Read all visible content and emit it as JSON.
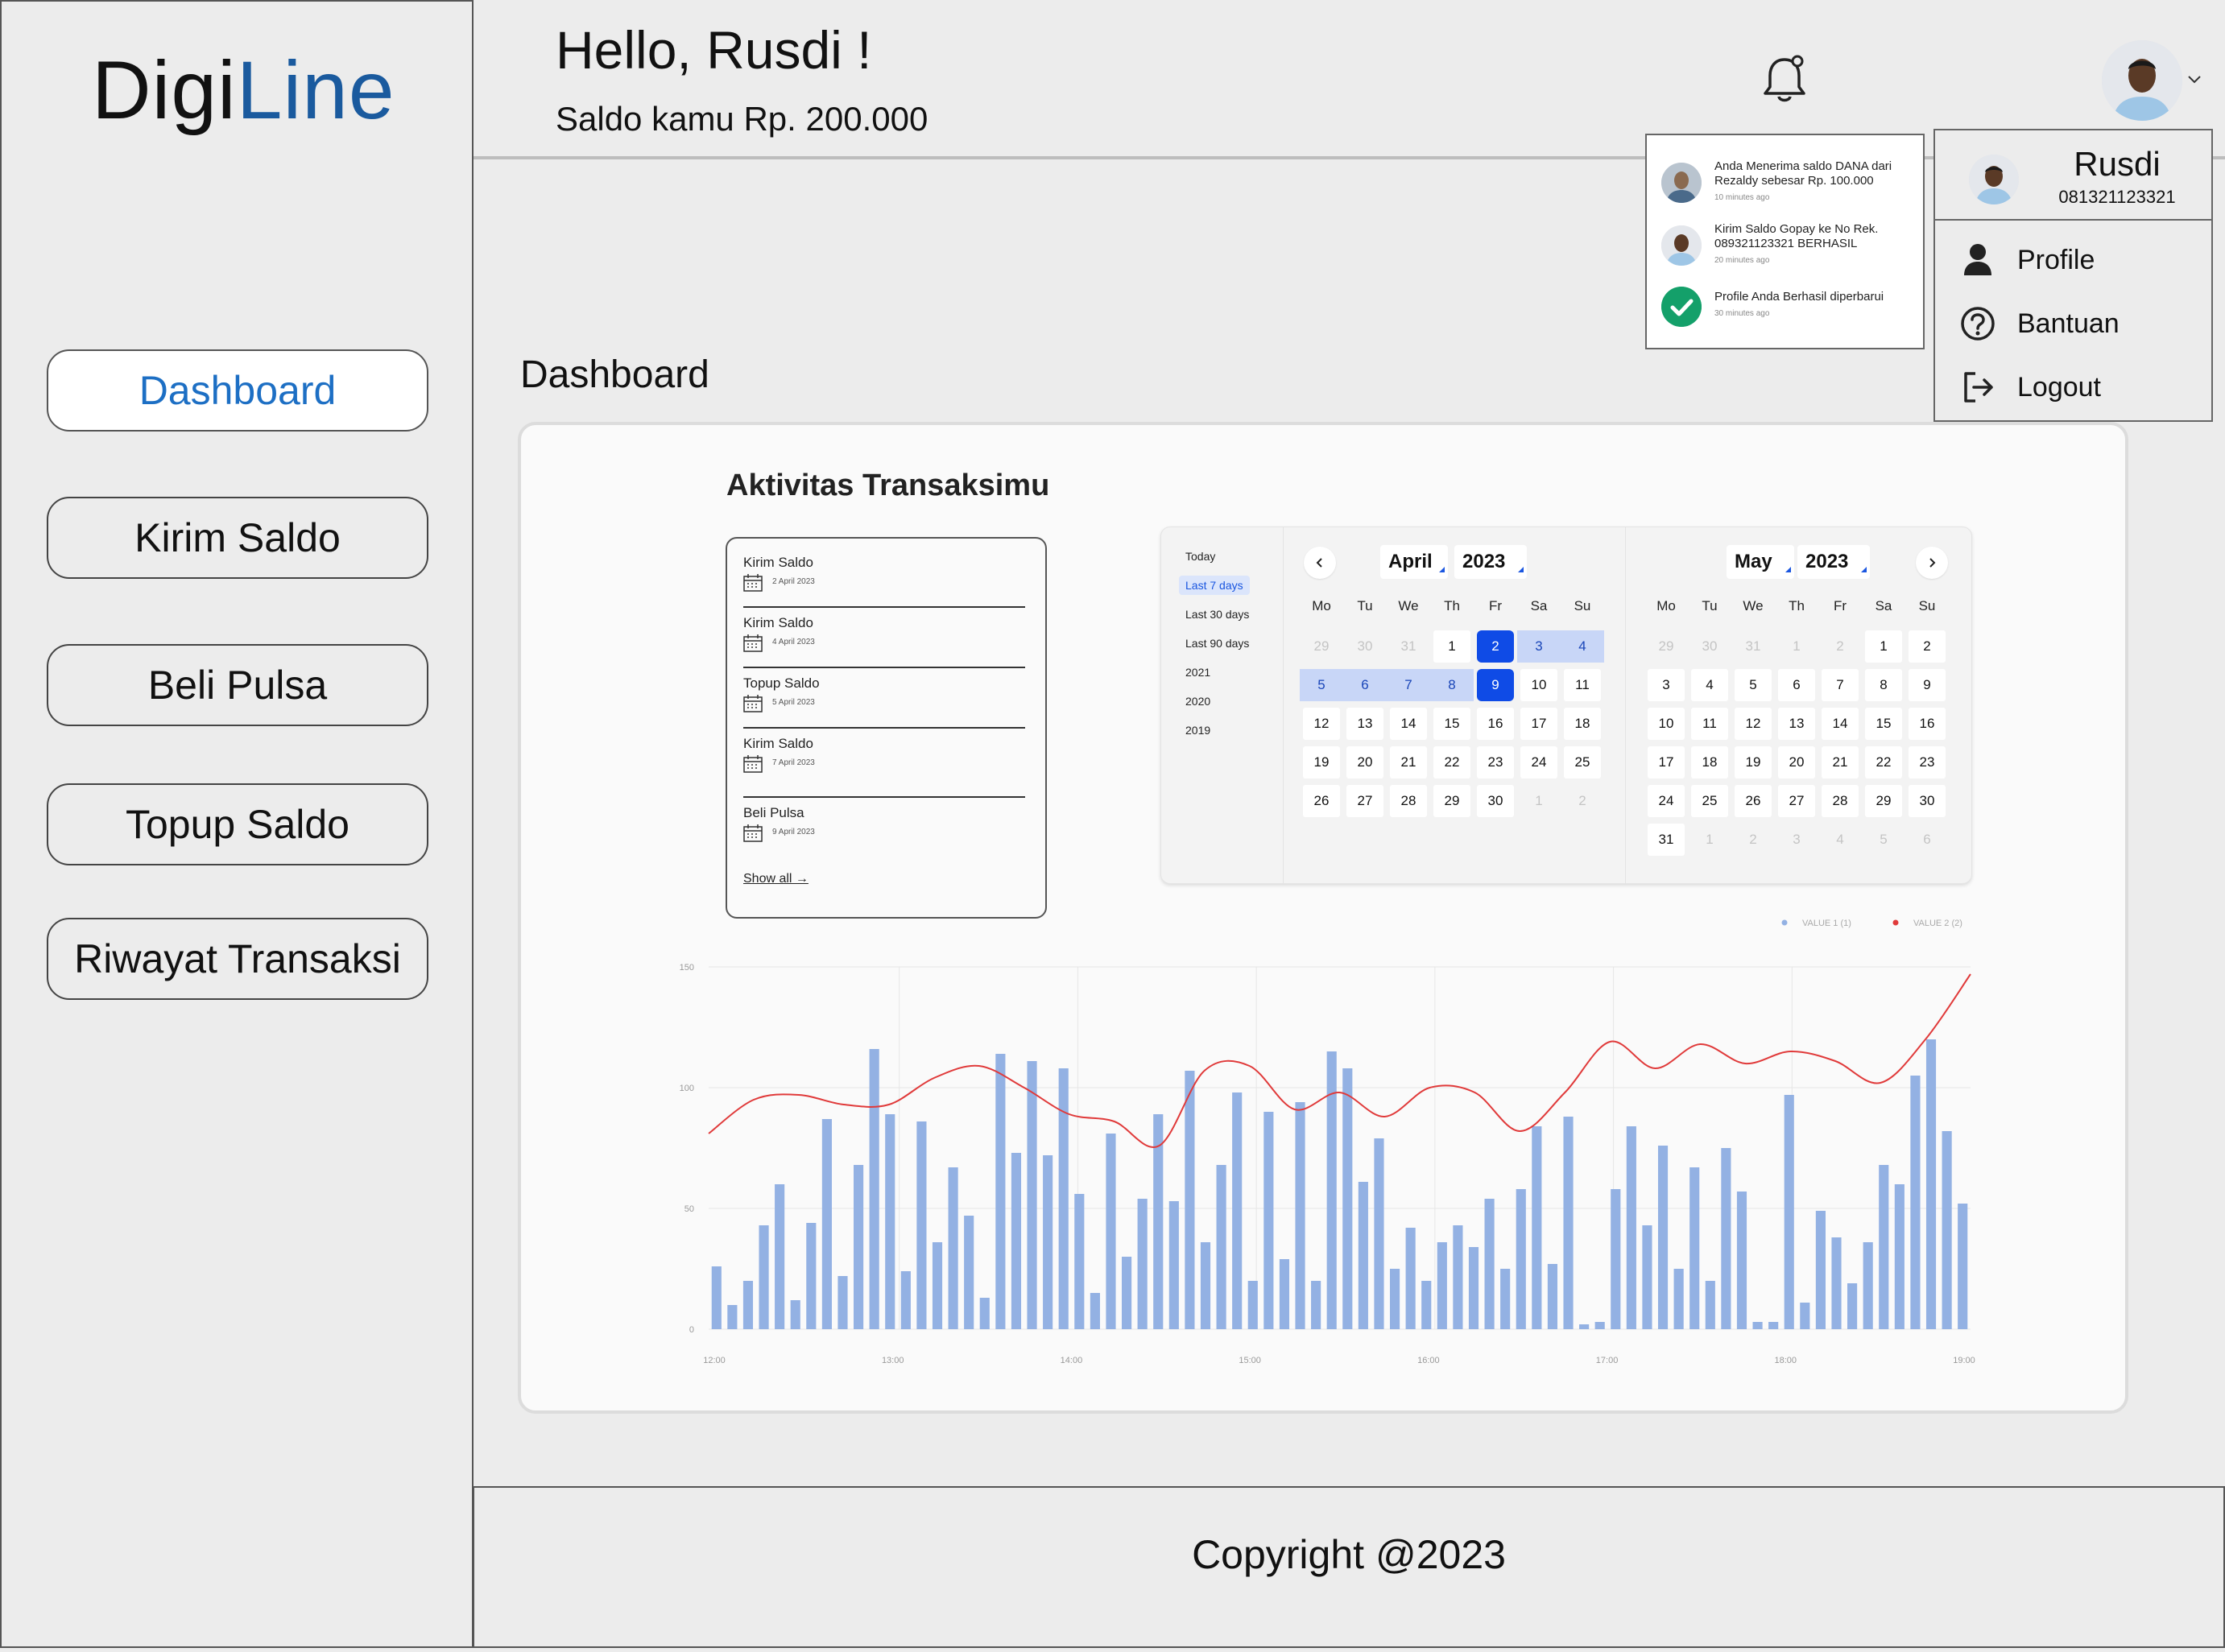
{
  "app": {
    "logo_a": "Digi",
    "logo_b": "Line"
  },
  "sidebar": {
    "items": [
      {
        "label": "Dashboard",
        "active": true
      },
      {
        "label": "Kirim Saldo"
      },
      {
        "label": "Beli Pulsa"
      },
      {
        "label": "Topup Saldo"
      },
      {
        "label": "Riwayat Transaksi"
      }
    ]
  },
  "header": {
    "greeting": "Hello, Rusdi !",
    "saldo": "Saldo kamu Rp. 200.000",
    "bell_icon": "bell-icon"
  },
  "notifications": [
    {
      "text": "Anda Menerima saldo DANA dari Rezaldy sebesar Rp. 100.000",
      "time": "10 minutes ago",
      "icon": "avatar"
    },
    {
      "text": "Kirim Saldo Gopay ke No Rek. 089321123321 BERHASIL",
      "time": "20 minutes ago",
      "icon": "avatar"
    },
    {
      "text": "Profile Anda Berhasil diperbarui",
      "time": "30 minutes ago",
      "icon": "check-circle-icon"
    }
  ],
  "profile_menu": {
    "name": "Rusdi",
    "phone": "081321123321",
    "items": [
      {
        "label": "Profile",
        "icon": "user-icon"
      },
      {
        "label": "Bantuan",
        "icon": "help-icon"
      },
      {
        "label": "Logout",
        "icon": "logout-icon"
      }
    ]
  },
  "main": {
    "title": "Dashboard",
    "card_title": "Aktivitas Transaksimu",
    "activity": [
      {
        "name": "Kirim Saldo",
        "date": "2 April 2023"
      },
      {
        "name": "Kirim Saldo",
        "date": "4 April 2023"
      },
      {
        "name": "Topup Saldo",
        "date": "5 April 2023"
      },
      {
        "name": "Kirim Saldo",
        "date": "7 April 2023"
      },
      {
        "name": "Beli Pulsa",
        "date": "9 April 2023"
      }
    ],
    "show_all": "Show all →"
  },
  "calendar": {
    "presets": [
      "Today",
      "Last 7 days",
      "Last 30 days",
      "Last 90 days",
      "2021",
      "2020",
      "2019"
    ],
    "selected_preset": "Last 7 days",
    "weekdays": [
      "Mo",
      "Tu",
      "We",
      "Th",
      "Fr",
      "Sa",
      "Su"
    ],
    "left": {
      "month": "April",
      "year": "2023",
      "weeks": [
        [
          "29",
          "30",
          "31",
          "1",
          "2",
          "3",
          "4"
        ],
        [
          "5",
          "6",
          "7",
          "8",
          "9",
          "10",
          "11"
        ],
        [
          "12",
          "13",
          "14",
          "15",
          "16",
          "17",
          "18"
        ],
        [
          "19",
          "20",
          "21",
          "22",
          "23",
          "24",
          "25"
        ],
        [
          "26",
          "27",
          "28",
          "29",
          "30",
          "1",
          "2"
        ]
      ]
    },
    "right": {
      "month": "May",
      "year": "2023",
      "weeks": [
        [
          "29",
          "30",
          "31",
          "1",
          "2",
          "1",
          "2"
        ],
        [
          "3",
          "4",
          "5",
          "6",
          "7",
          "8",
          "9"
        ],
        [
          "10",
          "11",
          "12",
          "13",
          "14",
          "15",
          "16"
        ],
        [
          "17",
          "18",
          "19",
          "20",
          "21",
          "22",
          "23"
        ],
        [
          "24",
          "25",
          "26",
          "27",
          "28",
          "29",
          "30"
        ],
        [
          "31",
          "1",
          "2",
          "3",
          "4",
          "5",
          "6"
        ]
      ]
    },
    "range_start": "2",
    "range_end": "9"
  },
  "chart_data": {
    "type": "bar",
    "x_ticks": [
      "12:00",
      "13:00",
      "14:00",
      "15:00",
      "16:00",
      "17:00",
      "18:00",
      "19:00"
    ],
    "y_ticks": [
      "0",
      "50",
      "100",
      "150"
    ],
    "ylim": [
      0,
      150
    ],
    "legend": [
      {
        "name": "VALUE 1 (1)",
        "color": "#93b1e3"
      },
      {
        "name": "VALUE 2 (2)",
        "color": "#e03a3a"
      }
    ],
    "bars": [
      26,
      10,
      20,
      43,
      60,
      12,
      44,
      87,
      22,
      68,
      116,
      89,
      24,
      86,
      36,
      67,
      47,
      13,
      114,
      73,
      111,
      72,
      108,
      56,
      15,
      81,
      30,
      54,
      89,
      53,
      107,
      36,
      68,
      98,
      20,
      90,
      29,
      94,
      20,
      115,
      108,
      61,
      79,
      25,
      42,
      20,
      36,
      43,
      34,
      54,
      25,
      58,
      84,
      27,
      88,
      2,
      3,
      58,
      84,
      43,
      76,
      25,
      67,
      20,
      75,
      57,
      3,
      3,
      97,
      11,
      49,
      38,
      19,
      36,
      68,
      60,
      105,
      120,
      82,
      52
    ],
    "line": {
      "x": [
        0,
        0.25,
        0.5,
        0.75,
        1,
        1.25,
        1.5,
        1.75,
        2,
        2.25,
        2.5,
        2.75,
        3,
        3.25,
        3.5,
        3.75,
        4,
        4.25,
        4.5,
        4.75,
        5,
        5.25,
        5.5,
        5.75,
        6,
        6.25,
        6.5,
        6.75,
        7
      ],
      "y": [
        81,
        95,
        97,
        93,
        93,
        104,
        109,
        100,
        89,
        86,
        76,
        107,
        109,
        91,
        98,
        88,
        100,
        98,
        82,
        98,
        119,
        108,
        118,
        110,
        115,
        111,
        102,
        120,
        147
      ]
    }
  },
  "footer": {
    "copyright": "Copyright @2023"
  }
}
